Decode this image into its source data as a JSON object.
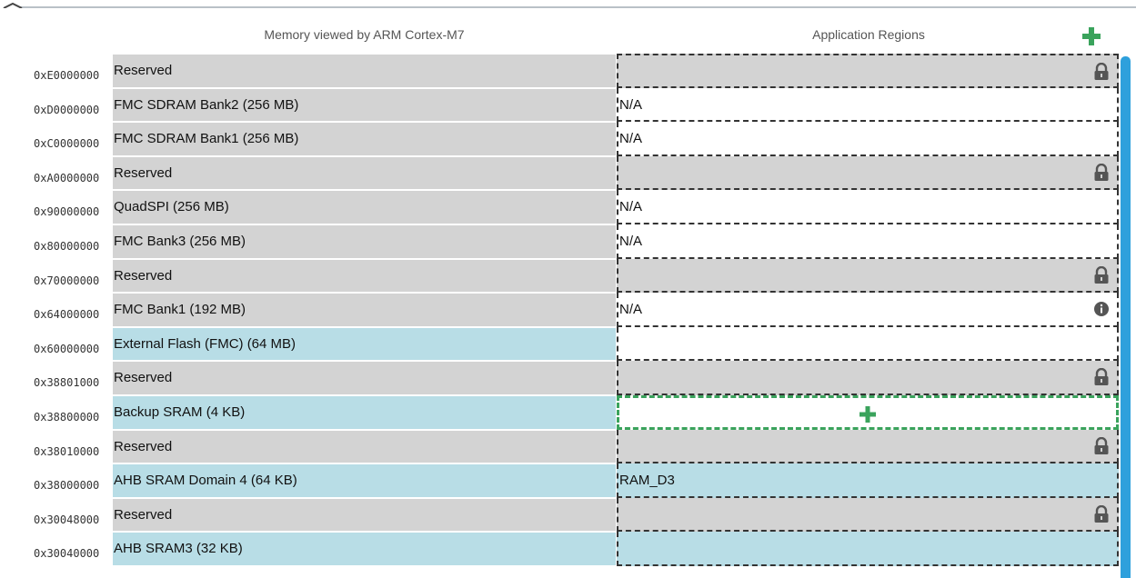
{
  "header": {
    "memory_title": "Memory viewed by ARM Cortex-M7",
    "regions_title": "Application Regions",
    "add_icon": "plus-icon",
    "accent_color": "#3aa35c"
  },
  "colors": {
    "reserved": "#d3d3d3",
    "internal": "#b8dde6",
    "scrollbar": "#2ea0dc"
  },
  "rows": [
    {
      "address": "0xE0000000",
      "memory": "Reserved",
      "kind": "reserved",
      "region": "",
      "region_kind": "locked",
      "icon": "lock-icon"
    },
    {
      "address": "0xD0000000",
      "memory": "FMC SDRAM Bank2 (256 MB)",
      "kind": "ext",
      "region": "N/A",
      "region_kind": "na",
      "icon": ""
    },
    {
      "address": "0xC0000000",
      "memory": "FMC SDRAM Bank1 (256 MB)",
      "kind": "ext",
      "region": "N/A",
      "region_kind": "na",
      "icon": ""
    },
    {
      "address": "0xA0000000",
      "memory": "Reserved",
      "kind": "reserved",
      "region": "",
      "region_kind": "locked",
      "icon": "lock-icon"
    },
    {
      "address": "0x90000000",
      "memory": "QuadSPI (256 MB)",
      "kind": "ext",
      "region": "N/A",
      "region_kind": "na",
      "icon": ""
    },
    {
      "address": "0x80000000",
      "memory": "FMC Bank3 (256 MB)",
      "kind": "ext",
      "region": "N/A",
      "region_kind": "na",
      "icon": ""
    },
    {
      "address": "0x70000000",
      "memory": "Reserved",
      "kind": "reserved",
      "region": "",
      "region_kind": "locked",
      "icon": "lock-icon"
    },
    {
      "address": "0x64000000",
      "memory": "FMC Bank1 (192 MB)",
      "kind": "ext",
      "region": "N/A",
      "region_kind": "na",
      "icon": "info-icon"
    },
    {
      "address": "0x60000000",
      "memory": "External Flash (FMC) (64 MB)",
      "kind": "int",
      "region": "",
      "region_kind": "free",
      "icon": ""
    },
    {
      "address": "0x38801000",
      "memory": "Reserved",
      "kind": "reserved",
      "region": "",
      "region_kind": "locked",
      "icon": "lock-icon"
    },
    {
      "address": "0x38800000",
      "memory": "Backup SRAM (4 KB)",
      "kind": "int",
      "region": "",
      "region_kind": "dropzone",
      "icon": "plus-icon"
    },
    {
      "address": "0x38010000",
      "memory": "Reserved",
      "kind": "reserved",
      "region": "",
      "region_kind": "locked",
      "icon": "lock-icon"
    },
    {
      "address": "0x38000000",
      "memory": "AHB SRAM Domain 4 (64 KB)",
      "kind": "int",
      "region": "RAM_D3",
      "region_kind": "ram",
      "icon": ""
    },
    {
      "address": "0x30048000",
      "memory": "Reserved",
      "kind": "reserved",
      "region": "",
      "region_kind": "locked",
      "icon": "lock-icon"
    },
    {
      "address": "0x30040000",
      "memory": "AHB SRAM3 (32 KB)",
      "kind": "int",
      "region": "",
      "region_kind": "ram",
      "icon": ""
    }
  ]
}
